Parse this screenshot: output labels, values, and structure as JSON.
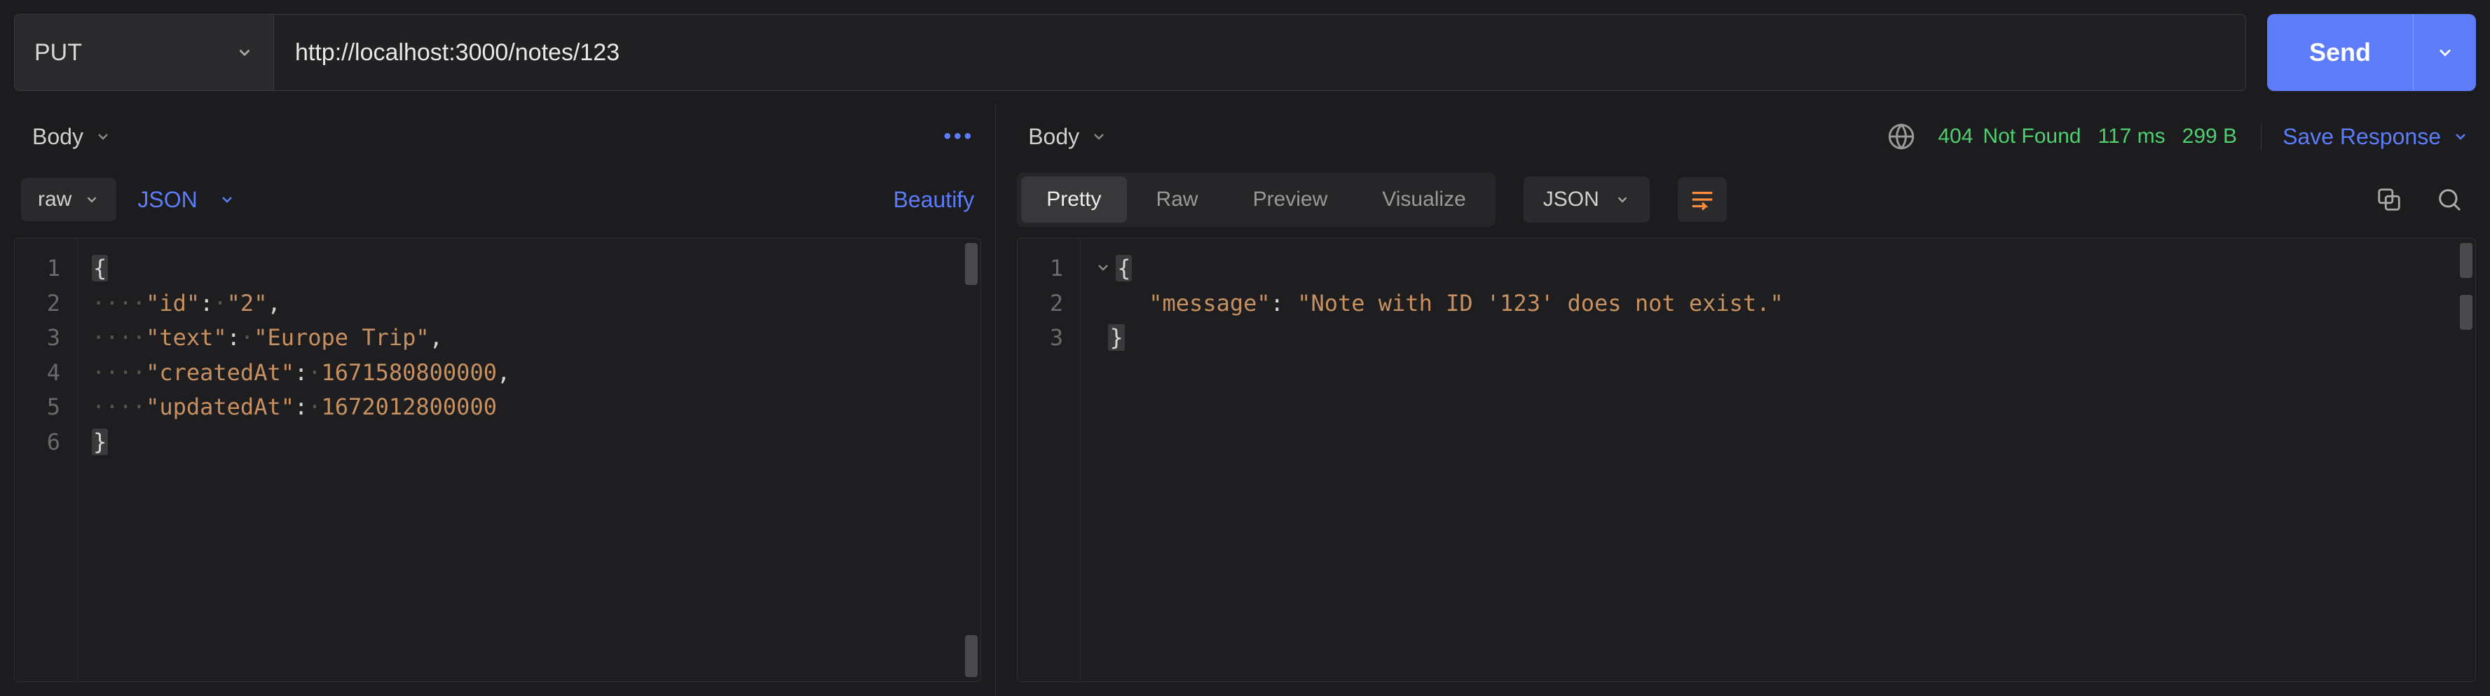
{
  "request": {
    "method": "PUT",
    "url": "http://localhost:3000/notes/123",
    "send_label": "Send"
  },
  "left": {
    "tab": "Body",
    "body_type": "raw",
    "format": "JSON",
    "beautify_label": "Beautify",
    "code_lines": [
      "1",
      "2",
      "3",
      "4",
      "5",
      "6"
    ],
    "body_json": {
      "id": "2",
      "text": "Europe Trip",
      "createdAt": 1671580800000,
      "updatedAt": 1672012800000
    }
  },
  "right": {
    "tab": "Body",
    "status_code": "404",
    "status_text": "Not Found",
    "time": "117 ms",
    "size": "299 B",
    "save_label": "Save Response",
    "view_tabs": {
      "pretty": "Pretty",
      "raw": "Raw",
      "preview": "Preview",
      "visualize": "Visualize"
    },
    "format": "JSON",
    "code_lines": [
      "1",
      "2",
      "3"
    ],
    "response_json": {
      "message": "Note with ID '123' does not exist."
    }
  }
}
